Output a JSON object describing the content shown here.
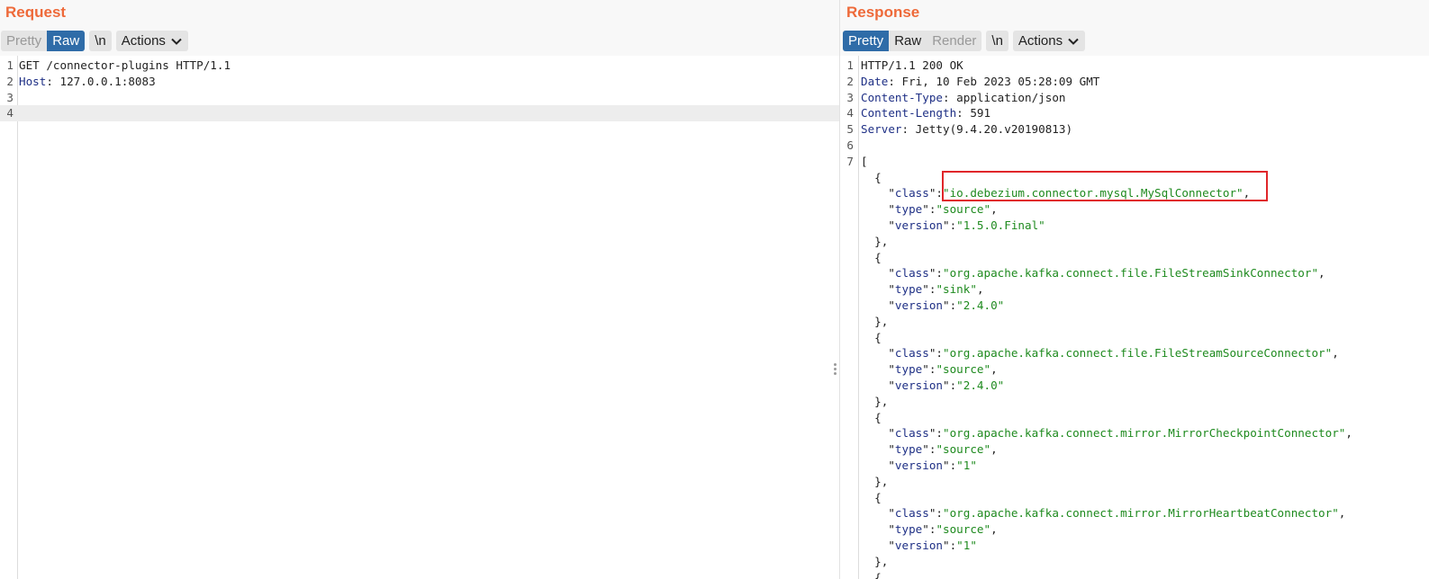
{
  "request": {
    "title": "Request",
    "tabs": [
      "Pretty",
      "Raw"
    ],
    "active_tab": "Raw",
    "newline_button": "\\n",
    "actions_button": "Actions",
    "lines": [
      {
        "n": "1",
        "text": "GET /connector-plugins HTTP/1.1"
      },
      {
        "n": "2",
        "key": "Host",
        "text": ": 127.0.0.1:8083"
      },
      {
        "n": "3",
        "text": ""
      },
      {
        "n": "4",
        "text": ""
      }
    ]
  },
  "response": {
    "title": "Response",
    "tabs": [
      "Pretty",
      "Raw",
      "Render"
    ],
    "active_tab": "Pretty",
    "newline_button": "\\n",
    "actions_button": "Actions",
    "header_lines": [
      {
        "n": "1",
        "text": "HTTP/1.1 200 OK"
      },
      {
        "n": "2",
        "key": "Date",
        "text": ": Fri, 10 Feb 2023 05:28:09 GMT"
      },
      {
        "n": "3",
        "key": "Content-Type",
        "text": ": application/json"
      },
      {
        "n": "4",
        "key": "Content-Length",
        "text": ": 591"
      },
      {
        "n": "5",
        "key": "Server",
        "text": ": Jetty(9.4.20.v20190813)"
      },
      {
        "n": "6",
        "text": ""
      },
      {
        "n": "7",
        "text": "["
      }
    ],
    "plugins": [
      {
        "class": "io.debezium.connector.mysql.MySqlConnector",
        "type": "source",
        "version": "1.5.0.Final",
        "highlighted": true
      },
      {
        "class": "org.apache.kafka.connect.file.FileStreamSinkConnector",
        "type": "sink",
        "version": "2.4.0"
      },
      {
        "class": "org.apache.kafka.connect.file.FileStreamSourceConnector",
        "type": "source",
        "version": "2.4.0"
      },
      {
        "class": "org.apache.kafka.connect.mirror.MirrorCheckpointConnector",
        "type": "source",
        "version": "1"
      },
      {
        "class": "org.apache.kafka.connect.mirror.MirrorHeartbeatConnector",
        "type": "source",
        "version": "1"
      }
    ]
  },
  "colors": {
    "title": "#ee6a3a",
    "active_tab": "#2f6ca8",
    "json_key": "#1e2f85",
    "json_string": "#1e8a1e",
    "highlight_box": "#e0262a"
  }
}
